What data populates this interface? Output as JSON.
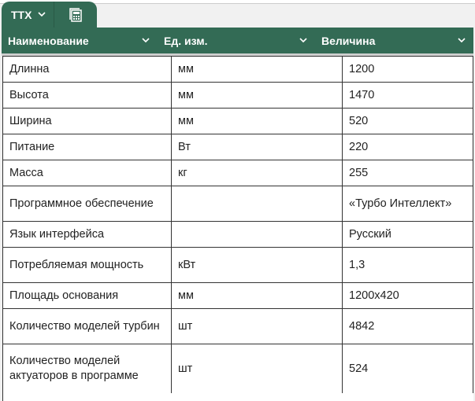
{
  "tabs": {
    "active": "ТТХ",
    "icon": "calculator-icon"
  },
  "columns": [
    "Наименование",
    "Ед. изм.",
    "Величина"
  ],
  "rows": [
    [
      "Длинна",
      "мм",
      "1200"
    ],
    [
      "Высота",
      "мм",
      "1470"
    ],
    [
      "Ширина",
      "мм",
      "520"
    ],
    [
      "Питание",
      "Вт",
      "220"
    ],
    [
      "Масса",
      "кг",
      "255"
    ],
    [
      "Программное обеспечение",
      "",
      "«Турбо Интеллект»"
    ],
    [
      "Язык интерфейса",
      "",
      "Русский"
    ],
    [
      "Потребляемая мощность",
      "кВт",
      "1,3"
    ],
    [
      "Площадь основания",
      "мм",
      "1200x420"
    ],
    [
      "Количество моделей турбин",
      "шт",
      "4842"
    ],
    [
      "Количество моделей актуаторов в программе",
      "шт",
      "524"
    ]
  ],
  "colors": {
    "header": "#336b55"
  }
}
